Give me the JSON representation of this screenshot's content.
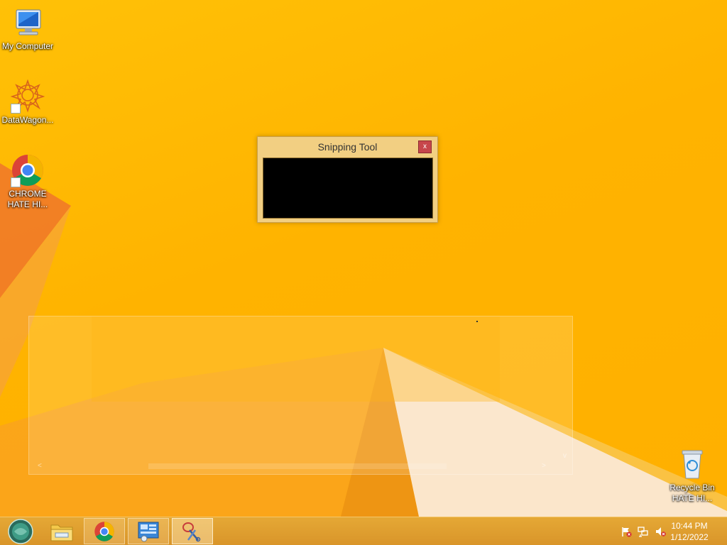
{
  "desktop": {
    "icons": [
      {
        "label": "My Computer",
        "icon": "computer-icon"
      },
      {
        "label": "DataWagon...",
        "icon": "datawagon-icon"
      },
      {
        "label": "CHROME HATE HI...",
        "icon": "chrome-icon"
      },
      {
        "label": "Recycle Bin HATE HI...",
        "icon": "recycle-bin-icon"
      }
    ]
  },
  "snipping_tool": {
    "title": "Snipping Tool",
    "close_label": "x"
  },
  "background_window": {
    "left_arrow": "<",
    "right_arrow": ">",
    "down_arrow": "v"
  },
  "taskbar": {
    "buttons": [
      {
        "name": "start-button",
        "icon": "start-orb-icon"
      },
      {
        "name": "file-explorer-button",
        "icon": "folder-icon"
      },
      {
        "name": "chrome-button",
        "icon": "chrome-icon"
      },
      {
        "name": "control-panel-button",
        "icon": "control-panel-icon"
      },
      {
        "name": "snipping-tool-button",
        "icon": "scissors-icon"
      }
    ],
    "tray": {
      "icons": [
        "action-center-flag-icon",
        "network-icon",
        "volume-muted-icon"
      ],
      "time": "10:44 PM",
      "date": "1/12/2022"
    }
  },
  "colors": {
    "wallpaper": "#ffb300",
    "taskbar": "#d9952a",
    "close_button": "#c7464b"
  }
}
